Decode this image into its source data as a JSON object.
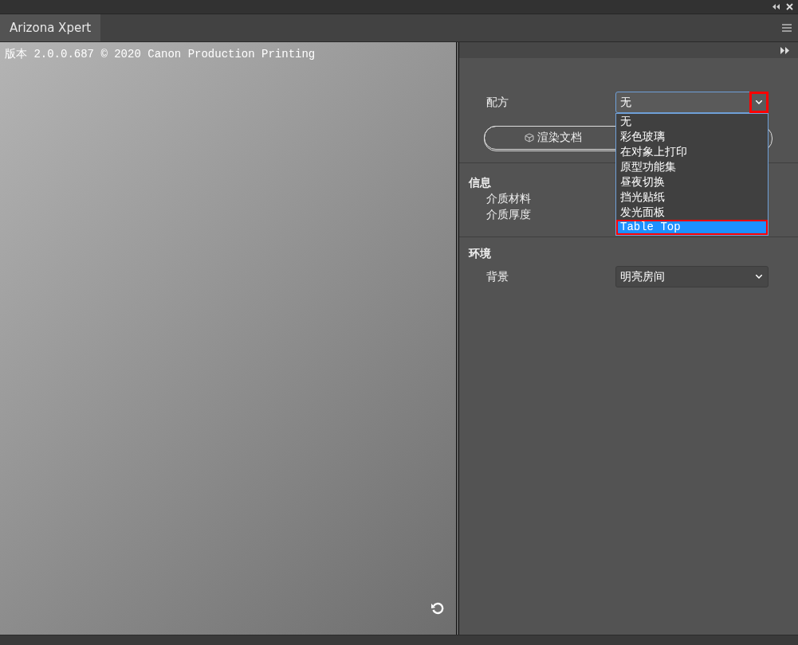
{
  "tab": {
    "label": "Arizona Xpert",
    "selected": true
  },
  "preview": {
    "version": "版本 2.0.0.687 © 2020 Canon Production Printing"
  },
  "recipe": {
    "label": "配方",
    "value": "无",
    "open": true,
    "caret_annotated": true,
    "options": [
      {
        "label": "无",
        "highlighted": false,
        "annotated": false
      },
      {
        "label": "彩色玻璃",
        "highlighted": false,
        "annotated": false
      },
      {
        "label": "在对象上打印",
        "highlighted": false,
        "annotated": false
      },
      {
        "label": "原型功能集",
        "highlighted": false,
        "annotated": false
      },
      {
        "label": "昼夜切换",
        "highlighted": false,
        "annotated": false
      },
      {
        "label": "挡光贴纸",
        "highlighted": false,
        "annotated": false
      },
      {
        "label": "发光面板",
        "highlighted": false,
        "annotated": false
      },
      {
        "label": "Table Top",
        "highlighted": true,
        "annotated": true
      }
    ]
  },
  "render_button": {
    "label": "渲染文档"
  },
  "info": {
    "title": "信息",
    "fields": [
      "介质材料",
      "介质厚度"
    ]
  },
  "environment": {
    "title": "环境",
    "fields": [
      {
        "label": "背景",
        "value": "明亮房间"
      }
    ]
  }
}
